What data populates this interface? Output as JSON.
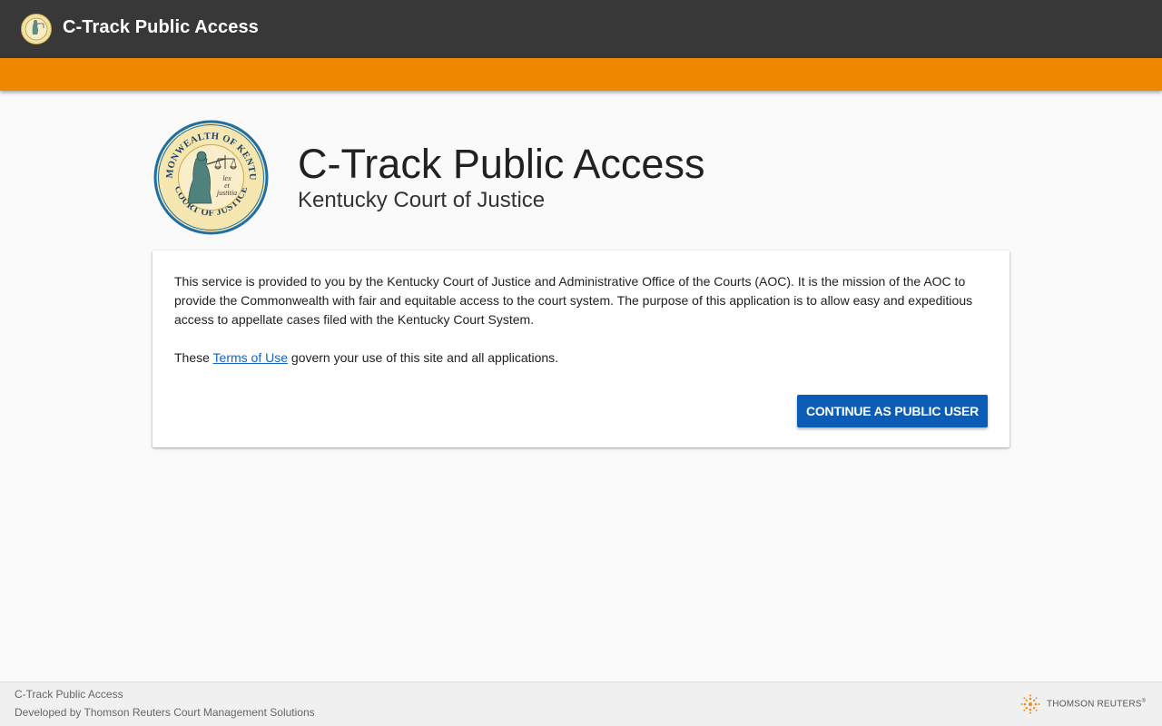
{
  "header": {
    "app_title": "C-Track Public Access",
    "logo_icon": "kentucky-seal-icon",
    "bar_color": "#383838",
    "accent_color": "#ef8700"
  },
  "hero": {
    "seal_icon": "kentucky-seal-icon",
    "seal_text_top": "COMMONWEALTH OF KENTUCKY",
    "seal_text_bottom": "COURT OF JUSTICE",
    "seal_motto": [
      "lex",
      "et",
      "justitia"
    ],
    "title": "C-Track Public Access",
    "subtitle": "Kentucky Court of Justice"
  },
  "card": {
    "intro_text": "This service is provided to you by the Kentucky Court of Justice and Administrative Office of the Courts (AOC). It is the mission of the AOC to provide the Commonwealth with fair and equitable access to the court system. The purpose of this application is to allow easy and expeditious access to appellate cases filed with the Kentucky Court System.",
    "terms_prefix": "These ",
    "terms_link": "Terms of Use",
    "terms_suffix": " govern your use of this site and all applications.",
    "continue_button": "CONTINUE AS PUBLIC USER",
    "button_color": "#0b5cb5"
  },
  "footer": {
    "line1": "C-Track Public Access",
    "line2": "Developed by Thomson Reuters Court Management Solutions",
    "vendor_logo": "THOMSON REUTERS",
    "vendor_mark": "®",
    "vendor_icon": "thomson-reuters-logo-icon"
  }
}
